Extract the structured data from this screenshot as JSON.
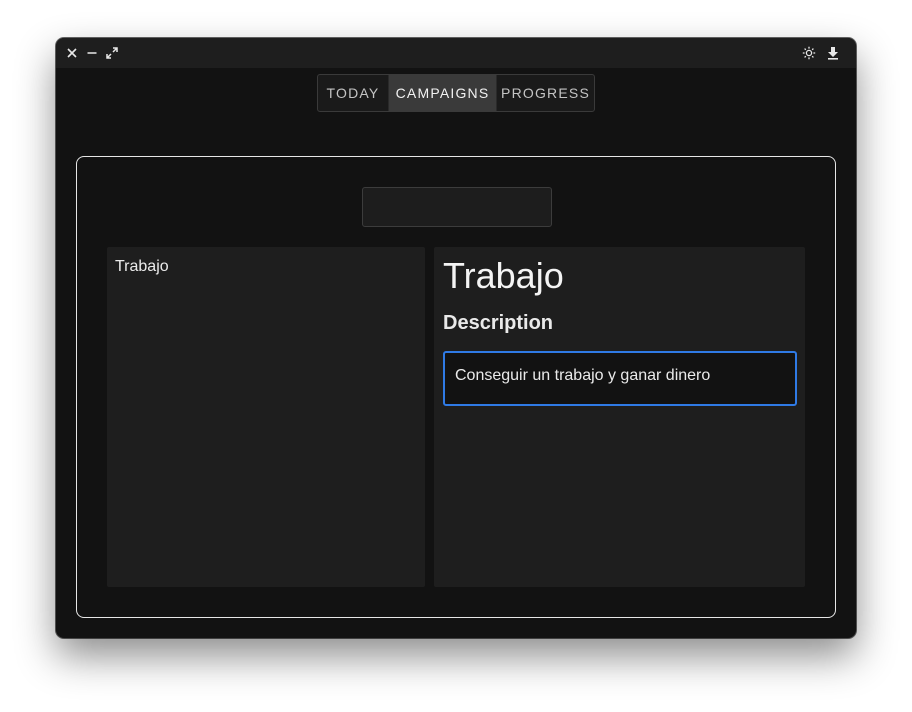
{
  "window": {
    "controls": {
      "close_icon": "close-icon",
      "minimize_icon": "minimize-icon",
      "maximize_icon": "expand-icon"
    },
    "actions": {
      "theme_icon": "sun-icon",
      "download_icon": "download-icon"
    }
  },
  "tabs": [
    {
      "label": "TODAY",
      "active": false
    },
    {
      "label": "CAMPAIGNS",
      "active": true
    },
    {
      "label": "PROGRESS",
      "active": false
    }
  ],
  "search": {
    "value": "",
    "placeholder": ""
  },
  "campaigns": {
    "items": [
      {
        "label": "Trabajo"
      }
    ]
  },
  "detail": {
    "title": "Trabajo",
    "description_heading": "Description",
    "description_value": "Conseguir un trabajo y ganar dinero"
  },
  "colors": {
    "accent": "#2f7ae5",
    "window_bg": "#121212",
    "pane_bg": "#1e1e1e",
    "active_tab_bg": "#3a3a3a"
  }
}
